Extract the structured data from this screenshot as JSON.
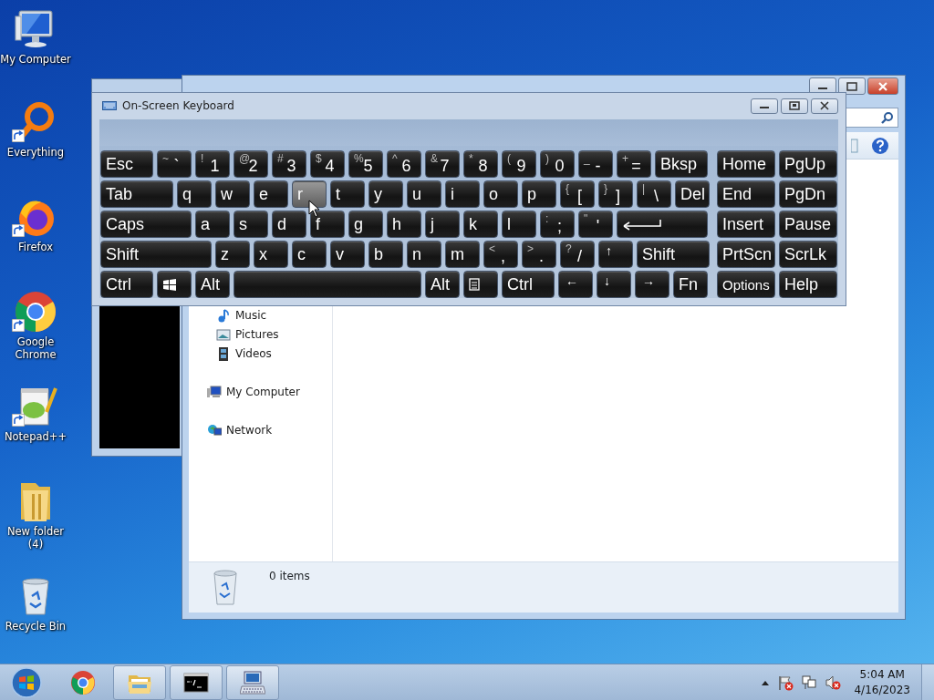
{
  "desktop_icons": [
    {
      "label": "My Computer",
      "kind": "computer",
      "shortcut": false
    },
    {
      "label": "Everything",
      "kind": "ring",
      "shortcut": true
    },
    {
      "label": "Firefox",
      "kind": "firefox",
      "shortcut": true
    },
    {
      "label": "Google Chrome",
      "kind": "chrome",
      "shortcut": true
    },
    {
      "label": "Notepad++",
      "kind": "notepad",
      "shortcut": true
    },
    {
      "label": "New folder (4)",
      "kind": "folder",
      "shortcut": false
    },
    {
      "label": "Recycle Bin",
      "kind": "bin",
      "shortcut": false
    }
  ],
  "explorer": {
    "nav_items": [
      {
        "children": [
          {
            "label": "Music",
            "kind": "music"
          },
          {
            "label": "Pictures",
            "kind": "pictures"
          },
          {
            "label": "Videos",
            "kind": "videos"
          }
        ]
      },
      {
        "label": "My Computer",
        "kind": "computer"
      },
      {
        "label": "Network",
        "kind": "network"
      }
    ],
    "status": "0 items"
  },
  "keyboard": {
    "title": "On-Screen Keyboard",
    "rows": [
      {
        "keys": [
          {
            "kind": "text",
            "label": "Esc",
            "hovered": false
          },
          {
            "kind": "dual",
            "shift": "~",
            "main": "`",
            "hovered": false
          },
          {
            "kind": "dual",
            "shift": "!",
            "main": "1",
            "hovered": false
          },
          {
            "kind": "dual",
            "shift": "@",
            "main": "2",
            "hovered": false
          },
          {
            "kind": "dual",
            "shift": "#",
            "main": "3",
            "hovered": false
          },
          {
            "kind": "dual",
            "shift": "$",
            "main": "4",
            "hovered": false
          },
          {
            "kind": "dual",
            "shift": "%",
            "main": "5",
            "hovered": false
          },
          {
            "kind": "dual",
            "shift": "^",
            "main": "6",
            "hovered": false
          },
          {
            "kind": "dual",
            "shift": "&",
            "main": "7",
            "hovered": false
          },
          {
            "kind": "dual",
            "shift": "*",
            "main": "8",
            "hovered": false
          },
          {
            "kind": "dual",
            "shift": "(",
            "main": "9",
            "hovered": false
          },
          {
            "kind": "dual",
            "shift": ")",
            "main": "0",
            "hovered": false
          },
          {
            "kind": "dual",
            "shift": "_",
            "main": "-",
            "hovered": false
          },
          {
            "kind": "dual",
            "shift": "+",
            "main": "=",
            "hovered": false
          },
          {
            "kind": "text",
            "label": "Bksp",
            "hovered": false
          }
        ]
      },
      {
        "keys": [
          {
            "kind": "text",
            "label": "Tab",
            "hovered": false
          },
          {
            "kind": "text",
            "label": "q",
            "hovered": false
          },
          {
            "kind": "text",
            "label": "w",
            "hovered": false
          },
          {
            "kind": "text",
            "label": "e",
            "hovered": false
          },
          {
            "kind": "text",
            "label": "r",
            "hovered": true
          },
          {
            "kind": "text",
            "label": "t",
            "hovered": false
          },
          {
            "kind": "text",
            "label": "y",
            "hovered": false
          },
          {
            "kind": "text",
            "label": "u",
            "hovered": false
          },
          {
            "kind": "text",
            "label": "i",
            "hovered": false
          },
          {
            "kind": "text",
            "label": "o",
            "hovered": false
          },
          {
            "kind": "text",
            "label": "p",
            "hovered": false
          },
          {
            "kind": "dual",
            "shift": "{",
            "main": "[",
            "hovered": false
          },
          {
            "kind": "dual",
            "shift": "}",
            "main": "]",
            "hovered": false
          },
          {
            "kind": "dual",
            "shift": "|",
            "main": "\\",
            "hovered": false
          },
          {
            "kind": "text",
            "label": "Del",
            "hovered": false
          }
        ]
      },
      {
        "keys": [
          {
            "kind": "text",
            "label": "Caps",
            "hovered": false
          },
          {
            "kind": "text",
            "label": "a",
            "hovered": false
          },
          {
            "kind": "text",
            "label": "s",
            "hovered": false
          },
          {
            "kind": "text",
            "label": "d",
            "hovered": false
          },
          {
            "kind": "text",
            "label": "f",
            "hovered": false
          },
          {
            "kind": "text",
            "label": "g",
            "hovered": false
          },
          {
            "kind": "text",
            "label": "h",
            "hovered": false
          },
          {
            "kind": "text",
            "label": "j",
            "hovered": false
          },
          {
            "kind": "text",
            "label": "k",
            "hovered": false
          },
          {
            "kind": "text",
            "label": "l",
            "hovered": false
          },
          {
            "kind": "dual",
            "shift": ":",
            "main": ";",
            "hovered": false
          },
          {
            "kind": "dual",
            "shift": "\"",
            "main": "'",
            "hovered": false
          },
          {
            "kind": "enter",
            "hovered": false
          }
        ]
      },
      {
        "keys": [
          {
            "kind": "text",
            "label": "Shift",
            "hovered": false
          },
          {
            "kind": "text",
            "label": "z",
            "hovered": false
          },
          {
            "kind": "text",
            "label": "x",
            "hovered": false
          },
          {
            "kind": "text",
            "label": "c",
            "hovered": false
          },
          {
            "kind": "text",
            "label": "v",
            "hovered": false
          },
          {
            "kind": "text",
            "label": "b",
            "hovered": false
          },
          {
            "kind": "text",
            "label": "n",
            "hovered": false
          },
          {
            "kind": "text",
            "label": "m",
            "hovered": false
          },
          {
            "kind": "dual",
            "shift": "<",
            "main": ",",
            "hovered": false
          },
          {
            "kind": "dual",
            "shift": ">",
            "main": ".",
            "hovered": false
          },
          {
            "kind": "dual",
            "shift": "?",
            "main": "/",
            "hovered": false
          },
          {
            "kind": "arrow",
            "label": "↑",
            "hovered": false
          },
          {
            "kind": "text",
            "label": "Shift",
            "hovered": false
          }
        ]
      },
      {
        "keys": [
          {
            "kind": "text",
            "label": "Ctrl",
            "hovered": false
          },
          {
            "kind": "windows",
            "hovered": false
          },
          {
            "kind": "text",
            "label": "Alt",
            "hovered": false
          },
          {
            "kind": "space",
            "hovered": false
          },
          {
            "kind": "text",
            "label": "Alt",
            "hovered": false
          },
          {
            "kind": "menu",
            "hovered": false
          },
          {
            "kind": "text",
            "label": "Ctrl",
            "hovered": false
          },
          {
            "kind": "arrow",
            "label": "←",
            "hovered": false
          },
          {
            "kind": "arrow",
            "label": "↓",
            "hovered": false
          },
          {
            "kind": "arrow",
            "label": "→",
            "hovered": false
          },
          {
            "kind": "text",
            "label": "Fn",
            "hovered": false
          }
        ]
      }
    ],
    "nav_rows": [
      {
        "keys": [
          {
            "label": "Home",
            "hovered": false
          },
          {
            "label": "PgUp",
            "hovered": false
          }
        ]
      },
      {
        "keys": [
          {
            "label": "End",
            "hovered": false
          },
          {
            "label": "PgDn",
            "hovered": false
          }
        ]
      },
      {
        "keys": [
          {
            "label": "Insert",
            "hovered": false
          },
          {
            "label": "Pause",
            "hovered": false
          }
        ]
      },
      {
        "keys": [
          {
            "label": "PrtScn",
            "hovered": false
          },
          {
            "label": "ScrLk",
            "hovered": false
          }
        ]
      },
      {
        "keys": [
          {
            "label": "Options",
            "hovered": false
          },
          {
            "label": "Help",
            "hovered": false
          }
        ]
      }
    ]
  },
  "taskbar": {
    "items": [
      {
        "kind": "chrome",
        "running": false
      },
      {
        "kind": "explorer",
        "running": true
      },
      {
        "kind": "cmd",
        "running": true
      },
      {
        "kind": "keyboard",
        "running": true
      }
    ],
    "time": "5:04 AM",
    "date": "4/16/2023"
  }
}
